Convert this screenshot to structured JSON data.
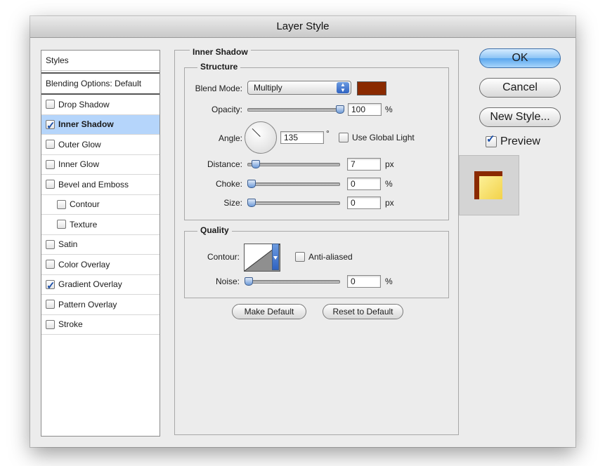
{
  "window": {
    "title": "Layer Style"
  },
  "styles_panel": {
    "header": "Styles",
    "blending": "Blending Options: Default",
    "items": [
      {
        "label": "Drop Shadow",
        "checked": false,
        "selected": false,
        "indent": false
      },
      {
        "label": "Inner Shadow",
        "checked": true,
        "selected": true,
        "indent": false
      },
      {
        "label": "Outer Glow",
        "checked": false,
        "selected": false,
        "indent": false
      },
      {
        "label": "Inner Glow",
        "checked": false,
        "selected": false,
        "indent": false
      },
      {
        "label": "Bevel and Emboss",
        "checked": false,
        "selected": false,
        "indent": false
      },
      {
        "label": "Contour",
        "checked": false,
        "selected": false,
        "indent": true
      },
      {
        "label": "Texture",
        "checked": false,
        "selected": false,
        "indent": true
      },
      {
        "label": "Satin",
        "checked": false,
        "selected": false,
        "indent": false
      },
      {
        "label": "Color Overlay",
        "checked": false,
        "selected": false,
        "indent": false
      },
      {
        "label": "Gradient Overlay",
        "checked": true,
        "selected": false,
        "indent": false
      },
      {
        "label": "Pattern Overlay",
        "checked": false,
        "selected": false,
        "indent": false
      },
      {
        "label": "Stroke",
        "checked": false,
        "selected": false,
        "indent": false
      }
    ]
  },
  "inner_shadow": {
    "title": "Inner Shadow",
    "structure": {
      "title": "Structure",
      "blend_mode_label": "Blend Mode:",
      "blend_mode_value": "Multiply",
      "shadow_color": "#8a2a00",
      "opacity_label": "Opacity:",
      "opacity_value": "100",
      "opacity_unit": "%",
      "opacity_level": 1.0,
      "angle_label": "Angle:",
      "angle_value": "135",
      "angle_unit": "°",
      "global_light_label": "Use Global Light",
      "global_light_checked": false,
      "distance_label": "Distance:",
      "distance_value": "7",
      "distance_unit": "px",
      "distance_level": 0.05,
      "choke_label": "Choke:",
      "choke_value": "0",
      "choke_unit": "%",
      "choke_level": 0,
      "size_label": "Size:",
      "size_value": "0",
      "size_unit": "px",
      "size_level": 0
    },
    "quality": {
      "title": "Quality",
      "contour_label": "Contour:",
      "anti_aliased_label": "Anti-aliased",
      "anti_aliased_checked": false,
      "noise_label": "Noise:",
      "noise_value": "0",
      "noise_unit": "%",
      "noise_level": 0
    },
    "make_default_label": "Make Default",
    "reset_default_label": "Reset to Default"
  },
  "buttons": {
    "ok": "OK",
    "cancel": "Cancel",
    "new_style": "New Style...",
    "preview_label": "Preview",
    "preview_checked": true
  },
  "colors": {
    "accent": "#5aa6ee",
    "selection": "#b5d5fb",
    "shadow_color": "#8a2a00"
  }
}
